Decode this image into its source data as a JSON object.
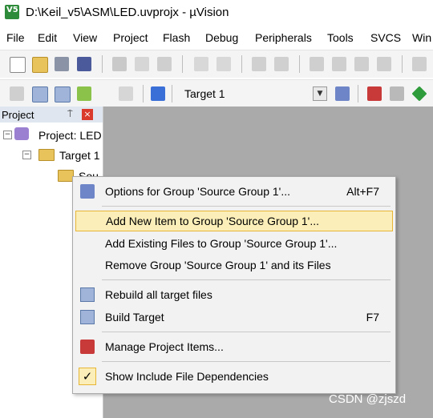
{
  "window": {
    "title": "D:\\Keil_v5\\ASM\\LED.uvprojx - µVision",
    "logo_text": "V5"
  },
  "menubar": {
    "items": [
      "File",
      "Edit",
      "View",
      "Project",
      "Flash",
      "Debug",
      "Peripherals",
      "Tools",
      "SVCS",
      "Win"
    ]
  },
  "toolbar": {
    "target_name": "Target 1"
  },
  "project_panel": {
    "title": "Project",
    "pin_glyph": "⍑",
    "close_glyph": "×",
    "tree": [
      {
        "label": "Project: LED",
        "expander": "−"
      },
      {
        "label": "Target 1",
        "expander": "−"
      },
      {
        "label": "Sou",
        "expander": ""
      }
    ]
  },
  "context_menu": {
    "items": [
      {
        "label": "Options for Group 'Source Group 1'...",
        "accelerator": "Alt+F7",
        "icon": "options-wand-icon"
      },
      {
        "label": "Add New  Item to Group 'Source Group 1'...",
        "accelerator": "",
        "icon": "",
        "highlighted": true
      },
      {
        "label": "Add Existing Files to Group 'Source Group 1'...",
        "accelerator": "",
        "icon": ""
      },
      {
        "label": "Remove Group 'Source Group 1' and its Files",
        "accelerator": "",
        "icon": ""
      },
      {
        "label": "Rebuild all target files",
        "accelerator": "",
        "icon": "rebuild-icon"
      },
      {
        "label": "Build Target",
        "accelerator": "F7",
        "icon": "build-icon"
      },
      {
        "label": "Manage Project Items...",
        "accelerator": "",
        "icon": "manage-items-icon"
      },
      {
        "label": "Show Include File Dependencies",
        "accelerator": "",
        "icon": "checkmark-icon",
        "checked": true
      }
    ],
    "check_glyph": "✓"
  },
  "watermark": "CSDN @zjszd",
  "colors": {
    "menu_highlight": "#fbeeb8",
    "menu_highlight_border": "#e6b634",
    "workspace_bg": "#aaaaaa",
    "close_red": "#d93a2b"
  }
}
